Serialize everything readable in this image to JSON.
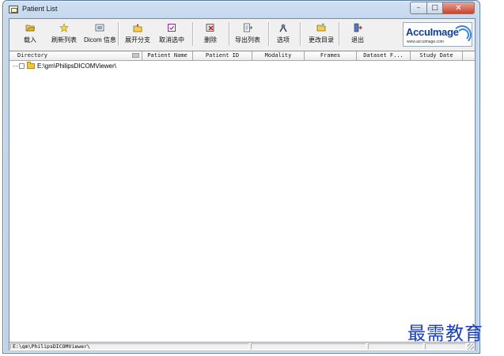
{
  "window": {
    "title": "Patient List",
    "close_glyph": "✕",
    "max_glyph": "□",
    "min_glyph": "–"
  },
  "toolbar": {
    "items": [
      {
        "label": "载入",
        "icon": "open-folder-icon"
      },
      {
        "label": "刷新列表",
        "icon": "refresh-star-icon"
      },
      {
        "label": "Dicom 信息",
        "icon": "dicom-info-icon"
      },
      {
        "label": "展开分支",
        "icon": "expand-branch-icon"
      },
      {
        "label": "取消选中",
        "icon": "uncheck-icon"
      },
      {
        "label": "删除",
        "icon": "delete-icon"
      },
      {
        "label": "导出列表",
        "icon": "export-list-icon"
      },
      {
        "label": "选项",
        "icon": "options-icon"
      },
      {
        "label": "更改目录",
        "icon": "change-directory-icon"
      },
      {
        "label": "退出",
        "icon": "exit-icon"
      }
    ],
    "logo": {
      "text": "AccuImage",
      "url": "www.accuimage.com"
    }
  },
  "list": {
    "columns": [
      "Directory",
      "Patient Name",
      "Patient ID",
      "Modality",
      "Frames",
      "Dataset F...",
      "Study Date"
    ],
    "tree": [
      {
        "label": "E:\\gm\\PhilipsDICOMViewer\\",
        "checked": false,
        "expanded": false
      }
    ]
  },
  "status": {
    "path": "E:\\gm\\PhilipsDICOMViewer\\",
    "pane2": "",
    "pane3": "",
    "pane4": ""
  },
  "watermark": "最需教育",
  "colors": {
    "title_bar": "#c5d8ee",
    "close_button": "#c9432e",
    "logo_blue": "#123f8f",
    "watermark_blue": "#1a3fb8"
  }
}
